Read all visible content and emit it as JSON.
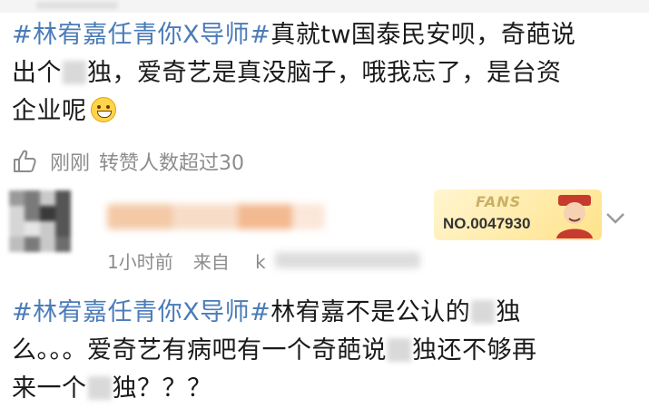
{
  "post": {
    "topic": "#林宥嘉任青你X导师#",
    "text_a": "真就tw国泰民安呗，奇葩说",
    "text_b": "出个",
    "text_c": "独，爱奇艺是真没脑子，哦我忘了，是台资",
    "text_d": "企业呢",
    "time": "刚刚",
    "reposts": "转赞人数超过30"
  },
  "comment": {
    "time": "1小时前",
    "source_label": "来自",
    "source_prefix": "k",
    "badge_title": "FANS",
    "badge_number": "NO.0047930",
    "topic": "#林宥嘉任青你X导师#",
    "text_a": "林宥嘉不是公认的",
    "text_b": "独",
    "text_c": "么。。。爱奇艺有病吧有一个奇葩说",
    "text_d": "独还不够再",
    "text_e": "来一个",
    "text_f": "独？？？"
  },
  "icons": [
    "thumbs-up-icon",
    "chevron-down-icon",
    "emoji-grin-icon"
  ],
  "colors": {
    "topic": "#4a7cb8",
    "meta": "#8c8c8c",
    "badge": "#ffe28a"
  }
}
